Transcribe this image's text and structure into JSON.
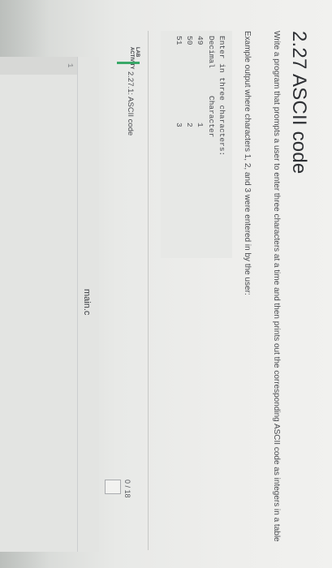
{
  "header": {
    "title": "2.27 ASCII code"
  },
  "instructions": {
    "description": "Write a program that prompts a user to enter three characters at a time and then prints out the corresponding ASCII code as integers in a table",
    "example_label": "Example output where characters 1, 2, and 3 were entered in by the user:"
  },
  "example_output": {
    "prompt": "Enter in three characters:",
    "col_decimal": "Decimal",
    "col_character": "Character",
    "rows": [
      {
        "decimal": "49",
        "character": "1"
      },
      {
        "decimal": "50",
        "character": "2"
      },
      {
        "decimal": "51",
        "character": "3"
      }
    ]
  },
  "lab": {
    "label_line1": "LAB",
    "label_line2": "ACTIVITY",
    "title": "2.27.1: ASCII code",
    "score": "0 / 18",
    "accent_color": "#39a868"
  },
  "editor": {
    "file_name": "main.c",
    "line_number": "1"
  }
}
